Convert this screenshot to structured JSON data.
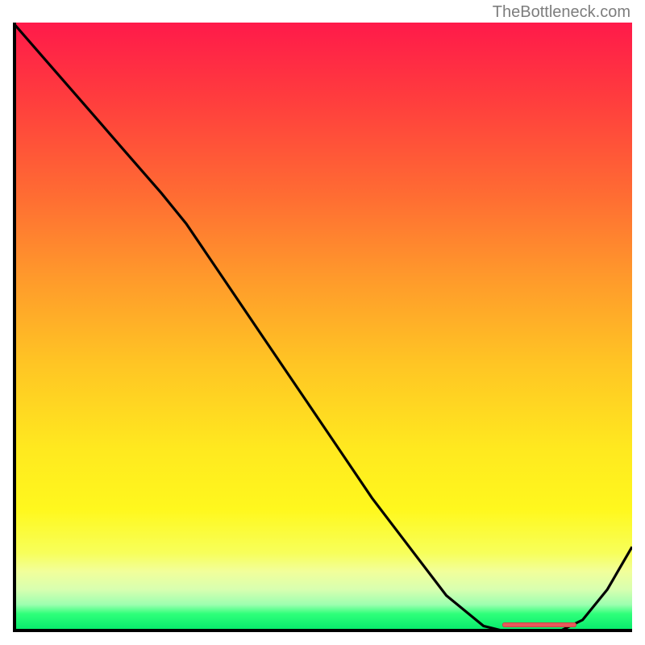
{
  "watermark": "TheBottleneck.com",
  "chart_data": {
    "type": "line",
    "title": "",
    "xlabel": "",
    "ylabel": "",
    "xlim": [
      0,
      100
    ],
    "ylim": [
      0,
      100
    ],
    "series": [
      {
        "name": "curve",
        "x": [
          0,
          6,
          12,
          18,
          24,
          28,
          34,
          40,
          46,
          52,
          58,
          64,
          70,
          76,
          80,
          84,
          88,
          92,
          96,
          100
        ],
        "y": [
          100,
          93,
          86,
          79,
          72,
          67,
          58,
          49,
          40,
          31,
          22,
          14,
          6,
          1,
          0,
          0,
          0,
          2,
          7,
          14
        ]
      }
    ],
    "marker": {
      "x_start": 79,
      "x_end": 91,
      "y": 0.4
    },
    "background_gradient": {
      "top": "#ff1a4a",
      "mid": "#ffe91f",
      "bottom": "#00e86a"
    }
  }
}
